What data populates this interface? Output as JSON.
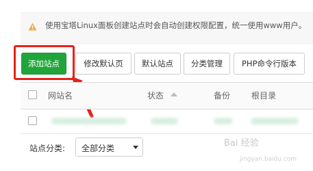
{
  "notice": {
    "icon": "warning-icon",
    "text": "使用宝塔Linux面板创建站点时会自动创建权限配置，统一使用www用户。"
  },
  "toolbar": {
    "add_site": "添加站点",
    "edit_default_page": "修改默认页",
    "default_site": "默认站点",
    "category_manage": "分类管理",
    "php_cli_version": "PHP命令行版本"
  },
  "table": {
    "columns": [
      "网站名",
      "状态",
      "备份",
      "根目录"
    ]
  },
  "filter": {
    "label": "站点分类:",
    "selected": "全部分类"
  },
  "watermark": {
    "brand": "Bai 经验",
    "url": "jingyan.baidu.com"
  },
  "colors": {
    "primary": "#20a53a",
    "highlight": "#e62118",
    "warning": "#f0ad4e"
  }
}
